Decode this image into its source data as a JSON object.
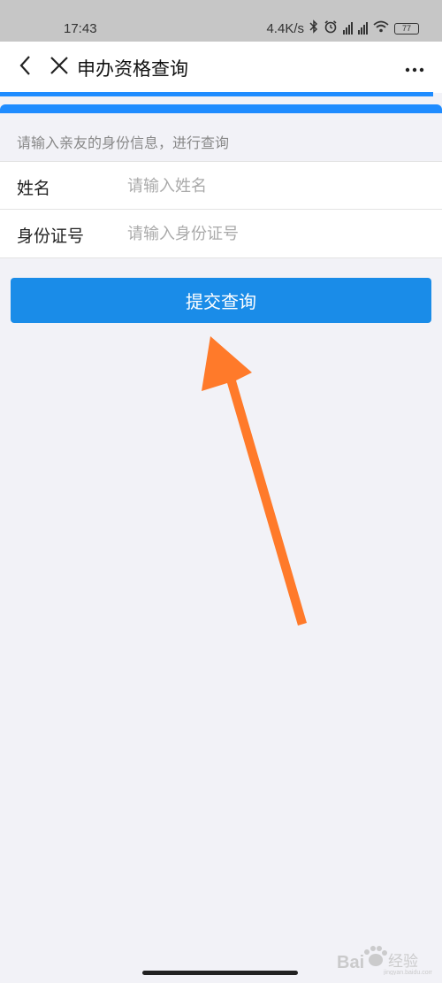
{
  "status_bar": {
    "time": "17:43",
    "net_speed": "4.4K/s",
    "battery_level": "77",
    "icons": [
      "bluetooth-icon",
      "alarm-icon",
      "signal-icon",
      "signal-icon",
      "wifi-icon",
      "battery-icon"
    ]
  },
  "header": {
    "back_icon": "chevron-left-icon",
    "close_icon": "close-icon",
    "title": "申办资格查询",
    "more_icon": "more-icon"
  },
  "form": {
    "hint": "请输入亲友的身份信息，进行查询",
    "fields": [
      {
        "label": "姓名",
        "placeholder": "请输入姓名",
        "value": ""
      },
      {
        "label": "身份证号",
        "placeholder": "请输入身份证号",
        "value": ""
      }
    ],
    "submit_label": "提交查询"
  },
  "overlay": {
    "arrow_color": "#ff7a2a"
  },
  "colors": {
    "accent": "#1a8ce8",
    "header_bar": "#1f8cff",
    "background": "#f2f2f7"
  }
}
